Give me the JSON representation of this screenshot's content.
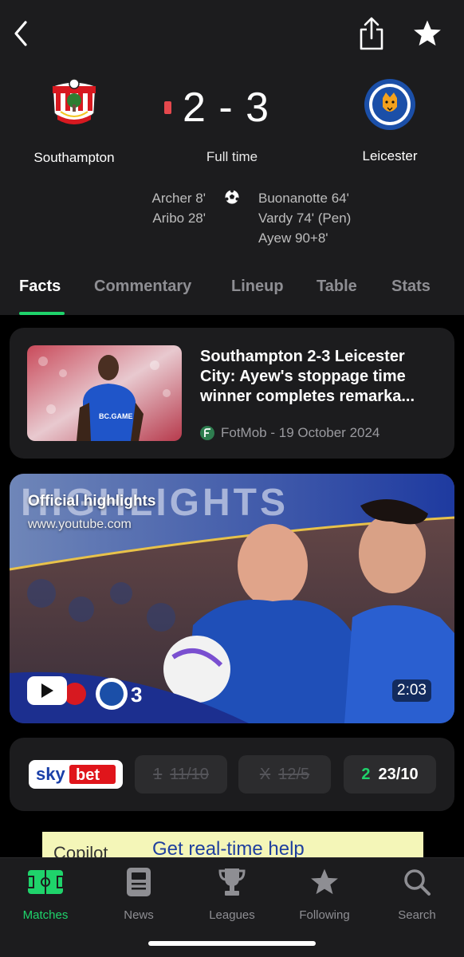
{
  "topbar": {
    "back_icon": "chevron-left-icon",
    "share_icon": "share-icon",
    "favorite_icon": "star-icon"
  },
  "match": {
    "home_team": "Southampton",
    "away_team": "Leicester",
    "score": "2 - 3",
    "status": "Full time",
    "home_scorers": [
      "Archer 8'",
      "Aribo 28'"
    ],
    "away_scorers": [
      "Buonanotte 64'",
      "Vardy 74' (Pen)",
      "Ayew 90+8'"
    ]
  },
  "tabs": [
    "Facts",
    "Commentary",
    "Lineup",
    "Table",
    "Stats"
  ],
  "news": {
    "title": "Southampton 2-3 Leicester City: Ayew's stoppage time winner completes remarka...",
    "source": "FotMob - 19 October 2024",
    "thumb_logo": "BC.GAME"
  },
  "video": {
    "title": "Official highlights",
    "source": "www.youtube.com",
    "duration": "2:03",
    "overlay_text": "HIGHLIGHTS",
    "overlay_score": "3"
  },
  "odds": {
    "provider": "sky bet",
    "options": [
      {
        "label": "1",
        "value": "11/10",
        "state": "dim"
      },
      {
        "label": "X",
        "value": "12/5",
        "state": "dim"
      },
      {
        "label": "2",
        "value": "23/10",
        "state": "live"
      }
    ]
  },
  "ad": {
    "brand": "Copilot",
    "text": "Get real-time help"
  },
  "bottom_nav": [
    {
      "label": "Matches",
      "icon": "pitch-icon",
      "active": true
    },
    {
      "label": "News",
      "icon": "newspaper-icon",
      "active": false
    },
    {
      "label": "Leagues",
      "icon": "trophy-icon",
      "active": false
    },
    {
      "label": "Following",
      "icon": "star-icon",
      "active": false
    },
    {
      "label": "Search",
      "icon": "search-icon",
      "active": false
    }
  ],
  "colors": {
    "accent": "#1fd36b",
    "background": "#000000",
    "surface": "#1c1c1e",
    "red_card": "#e5484d"
  }
}
